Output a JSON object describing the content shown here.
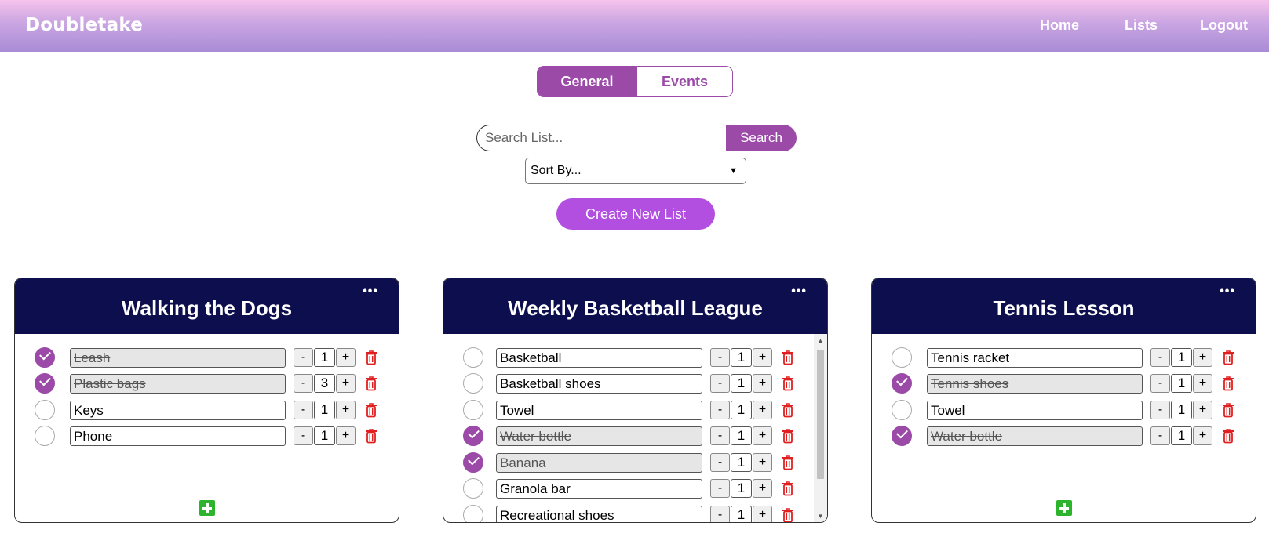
{
  "header": {
    "brand": "Doubletake",
    "nav": [
      "Home",
      "Lists",
      "Logout"
    ]
  },
  "tabs": {
    "active": "General",
    "inactive": "Events"
  },
  "search": {
    "placeholder": "Search List...",
    "button": "Search"
  },
  "sort": {
    "selected": "Sort By..."
  },
  "create_button": "Create New List",
  "lists": [
    {
      "title": "Walking the Dogs",
      "menu": "•••",
      "items": [
        {
          "name": "Leash",
          "done": true,
          "qty": "1"
        },
        {
          "name": "Plastic bags",
          "done": true,
          "qty": "3"
        },
        {
          "name": "Keys",
          "done": false,
          "qty": "1"
        },
        {
          "name": "Phone",
          "done": false,
          "qty": "1"
        }
      ]
    },
    {
      "title": "Weekly Basketball League",
      "menu": "•••",
      "items": [
        {
          "name": "Basketball",
          "done": false,
          "qty": "1"
        },
        {
          "name": "Basketball shoes",
          "done": false,
          "qty": "1"
        },
        {
          "name": "Towel",
          "done": false,
          "qty": "1"
        },
        {
          "name": "Water bottle",
          "done": true,
          "qty": "1"
        },
        {
          "name": "Banana",
          "done": true,
          "qty": "1"
        },
        {
          "name": "Granola bar",
          "done": false,
          "qty": "1"
        },
        {
          "name": "Recreational shoes",
          "done": false,
          "qty": "1"
        }
      ]
    },
    {
      "title": "Tennis Lesson",
      "menu": "•••",
      "items": [
        {
          "name": "Tennis racket",
          "done": false,
          "qty": "1"
        },
        {
          "name": "Tennis shoes",
          "done": true,
          "qty": "1"
        },
        {
          "name": "Towel",
          "done": false,
          "qty": "1"
        },
        {
          "name": "Water bottle",
          "done": true,
          "qty": "1"
        }
      ]
    }
  ],
  "qty_controls": {
    "minus": "-",
    "plus": "+"
  },
  "colors": {
    "accent": "#9b4aa8",
    "create": "#b24ee0",
    "card_header": "#0c0e4e",
    "trash": "#e02020",
    "add": "#2cb52c"
  },
  "icons": {
    "trash": "trash-icon",
    "add": "plus-square-icon",
    "menu": "more-icon",
    "check": "check-icon"
  }
}
